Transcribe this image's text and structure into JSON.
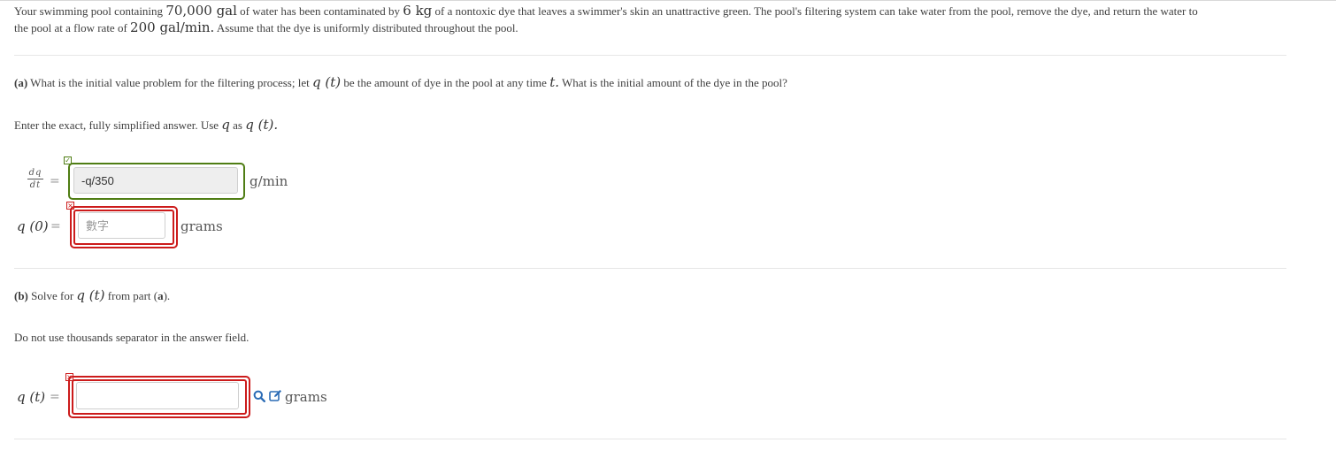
{
  "problem": {
    "intro_1": "Your swimming pool containing ",
    "volume": "70,000 gal",
    "intro_2": " of water has been contaminated by ",
    "dye_mass": "6 kg",
    "intro_3": " of a nontoxic dye that leaves a swimmer's skin an unattractive green. The pool's filtering system can take water from the pool, remove the dye, and return the water to",
    "intro_4": "the pool at a flow rate of ",
    "flow_rate": "200 gal/min.",
    "intro_5": " Assume that the dye is uniformly distributed throughout the pool."
  },
  "part_a": {
    "label": "(a)",
    "question_1": " What is the initial value problem for the filtering process; let ",
    "q_of_t": "q (t)",
    "question_2": " be the amount of dye in the pool at any time ",
    "t": "t.",
    "question_3": " What is the initial amount of the dye in the pool?",
    "instruction_1": "Enter the exact, fully simplified answer. Use ",
    "q": "q",
    "instruction_2": " as ",
    "q_of_t_dot": "q (t).",
    "deriv_num": "dq",
    "deriv_den": "dt",
    "equals": "=",
    "dq_value": "-q/350",
    "dq_unit": "g/min",
    "q0_label": "q (0)",
    "q0_placeholder": "數字",
    "q0_unit": "grams",
    "mark_correct": "✓",
    "mark_incorrect": "×"
  },
  "part_b": {
    "label": "(b)",
    "text_1": " Solve for ",
    "q_of_t": "q (t)",
    "text_2": " from part (",
    "part_ref": "a",
    "text_3": ").",
    "instruction": "Do not use thousands separator in the answer field.",
    "qt_label": "q (t)",
    "equals": "=",
    "qt_value": "",
    "qt_unit": "grams",
    "mark_incorrect": "×"
  },
  "icons": [
    "search-icon",
    "edit-icon"
  ],
  "colors": {
    "correct": "#4f7d14",
    "incorrect": "#cc1b1b",
    "link": "#2a6bb5"
  }
}
